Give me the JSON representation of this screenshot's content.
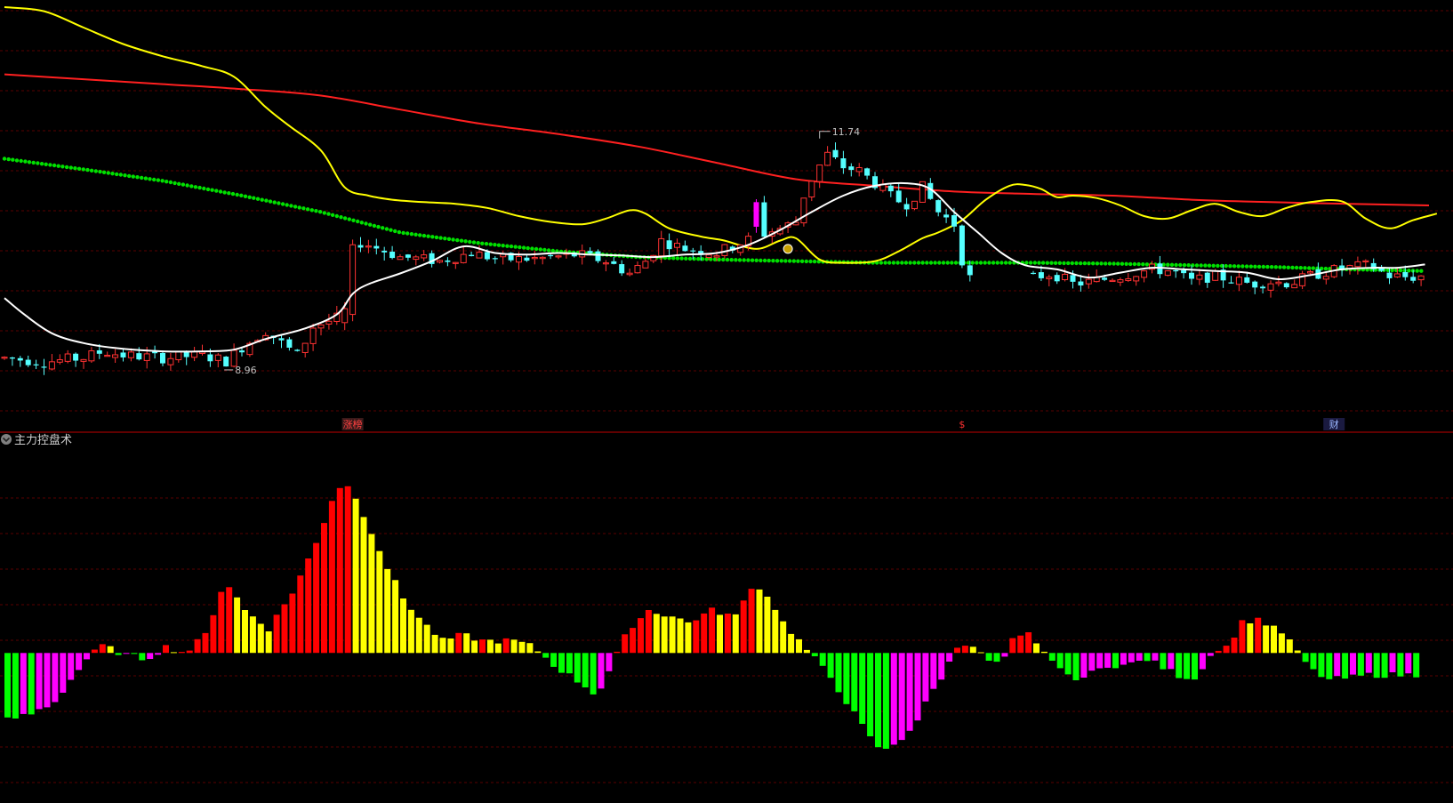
{
  "panel": {
    "indicator_name": "主力控盘术",
    "collapse_icon": "circle-chevron-down-icon"
  },
  "price_labels": {
    "low": "8.96",
    "high": "11.74"
  },
  "event_markers": [
    {
      "text": "涨榜",
      "color": "#ff4040",
      "bg": "#3a1a1a",
      "index": 88
    },
    {
      "text": "$",
      "color": "#ff3030",
      "bg": "",
      "index": 242
    },
    {
      "text": "财",
      "color": "#9bb8ff",
      "bg": "#1a1a40",
      "index": 336
    }
  ],
  "colors": {
    "background": "#000000",
    "grid": "#5a0000",
    "separator": "#c00000",
    "up_candle": "#ff3232",
    "down_candle": "#54ffff",
    "ma_white": "#ffffff",
    "ma_yellow": "#ffff00",
    "ma_red": "#ff2020",
    "dotted_green": "#00e000",
    "bar_red": "#ff0000",
    "bar_yellow": "#ffff00",
    "bar_green": "#00ff00",
    "bar_magenta": "#ff00ff"
  },
  "chart_data": [
    {
      "type": "candlestick",
      "x_range": [
        0,
        365
      ],
      "ylim": [
        8.2,
        13.3
      ],
      "grid": "dashed horizontal",
      "anchors": [
        [
          0,
          9.02
        ],
        [
          10,
          8.97
        ],
        [
          20,
          9.02
        ],
        [
          25,
          9.1
        ],
        [
          30,
          9.05
        ],
        [
          40,
          9.02
        ],
        [
          50,
          9.05
        ],
        [
          56,
          8.98
        ],
        [
          60,
          9.15
        ],
        [
          66,
          9.35
        ],
        [
          70,
          9.2
        ],
        [
          74,
          9.05
        ],
        [
          78,
          9.4
        ],
        [
          84,
          9.5
        ],
        [
          88,
          10.45
        ],
        [
          92,
          10.4
        ],
        [
          100,
          10.25
        ],
        [
          110,
          10.2
        ],
        [
          118,
          10.3
        ],
        [
          125,
          10.22
        ],
        [
          135,
          10.23
        ],
        [
          145,
          10.28
        ],
        [
          152,
          10.2
        ],
        [
          158,
          10.05
        ],
        [
          162,
          10.2
        ],
        [
          166,
          10.45
        ],
        [
          172,
          10.35
        ],
        [
          180,
          10.3
        ],
        [
          190,
          10.5
        ],
        [
          196,
          10.6
        ],
        [
          200,
          10.68
        ],
        [
          202,
          11.0
        ],
        [
          205,
          11.3
        ],
        [
          208,
          11.5
        ],
        [
          212,
          11.35
        ],
        [
          216,
          11.3
        ],
        [
          220,
          11.15
        ],
        [
          225,
          10.95
        ],
        [
          228,
          10.9
        ],
        [
          232,
          11.1
        ],
        [
          236,
          10.8
        ],
        [
          240,
          10.65
        ],
        [
          243,
          10.0
        ],
        [
          250,
          9.95
        ],
        [
          255,
          9.92
        ],
        [
          260,
          10.0
        ],
        [
          265,
          10.05
        ],
        [
          270,
          9.92
        ],
        [
          275,
          9.95
        ],
        [
          280,
          10.0
        ],
        [
          285,
          10.05
        ],
        [
          290,
          10.1
        ],
        [
          295,
          10.08
        ],
        [
          300,
          9.95
        ],
        [
          305,
          10.02
        ],
        [
          310,
          9.98
        ],
        [
          315,
          9.92
        ],
        [
          320,
          9.95
        ],
        [
          325,
          9.93
        ],
        [
          330,
          10.02
        ],
        [
          335,
          10.08
        ],
        [
          340,
          10.12
        ],
        [
          345,
          10.15
        ],
        [
          350,
          10.02
        ],
        [
          355,
          10.0
        ],
        [
          359,
          10.02
        ]
      ],
      "gaps": [
        [
          244,
          260
        ]
      ],
      "high_point": {
        "index": 206,
        "value": 11.74
      },
      "low_point": {
        "index": 56,
        "value": 8.96
      },
      "series": [
        {
          "name": "",
          "type": "line",
          "color": "#ffffff",
          "points": [
            [
              0,
              9.75
            ],
            [
              5,
              9.55
            ],
            [
              12,
              9.32
            ],
            [
              20,
              9.2
            ],
            [
              30,
              9.13
            ],
            [
              40,
              9.1
            ],
            [
              50,
              9.1
            ],
            [
              58,
              9.12
            ],
            [
              66,
              9.25
            ],
            [
              76,
              9.38
            ],
            [
              84,
              9.55
            ],
            [
              88,
              9.8
            ],
            [
              92,
              9.92
            ],
            [
              100,
              10.05
            ],
            [
              108,
              10.2
            ],
            [
              116,
              10.38
            ],
            [
              124,
              10.3
            ],
            [
              132,
              10.28
            ],
            [
              140,
              10.3
            ],
            [
              148,
              10.28
            ],
            [
              156,
              10.27
            ],
            [
              164,
              10.25
            ],
            [
              172,
              10.28
            ],
            [
              180,
              10.3
            ],
            [
              188,
              10.4
            ],
            [
              196,
              10.58
            ],
            [
              204,
              10.8
            ],
            [
              212,
              11.0
            ],
            [
              220,
              11.12
            ],
            [
              228,
              11.15
            ],
            [
              234,
              11.08
            ],
            [
              240,
              10.8
            ],
            [
              246,
              10.55
            ],
            [
              252,
              10.3
            ],
            [
              258,
              10.15
            ],
            [
              266,
              10.1
            ],
            [
              274,
              10.0
            ],
            [
              282,
              10.06
            ],
            [
              290,
              10.12
            ],
            [
              298,
              10.1
            ],
            [
              306,
              10.08
            ],
            [
              314,
              10.06
            ],
            [
              322,
              9.98
            ],
            [
              330,
              10.03
            ],
            [
              338,
              10.1
            ],
            [
              346,
              10.12
            ],
            [
              352,
              10.12
            ],
            [
              359,
              10.16
            ]
          ]
        },
        {
          "name": "",
          "type": "line",
          "color": "#ffff00",
          "points": [
            [
              0,
              13.3
            ],
            [
              10,
              13.25
            ],
            [
              20,
              13.05
            ],
            [
              30,
              12.85
            ],
            [
              40,
              12.7
            ],
            [
              50,
              12.58
            ],
            [
              58,
              12.45
            ],
            [
              66,
              12.08
            ],
            [
              72,
              11.85
            ],
            [
              80,
              11.55
            ],
            [
              86,
              11.1
            ],
            [
              92,
              11.0
            ],
            [
              98,
              10.95
            ],
            [
              106,
              10.92
            ],
            [
              114,
              10.9
            ],
            [
              122,
              10.85
            ],
            [
              130,
              10.75
            ],
            [
              138,
              10.68
            ],
            [
              146,
              10.65
            ],
            [
              152,
              10.72
            ],
            [
              158,
              10.82
            ],
            [
              162,
              10.78
            ],
            [
              168,
              10.6
            ],
            [
              176,
              10.5
            ],
            [
              182,
              10.45
            ],
            [
              190,
              10.35
            ],
            [
              196,
              10.45
            ],
            [
              200,
              10.48
            ],
            [
              206,
              10.22
            ],
            [
              212,
              10.18
            ],
            [
              220,
              10.2
            ],
            [
              226,
              10.32
            ],
            [
              232,
              10.48
            ],
            [
              236,
              10.55
            ],
            [
              242,
              10.7
            ],
            [
              248,
              10.95
            ],
            [
              254,
              11.12
            ],
            [
              258,
              11.13
            ],
            [
              262,
              11.08
            ],
            [
              266,
              10.98
            ],
            [
              270,
              11.0
            ],
            [
              276,
              10.97
            ],
            [
              282,
              10.88
            ],
            [
              288,
              10.75
            ],
            [
              294,
              10.72
            ],
            [
              300,
              10.82
            ],
            [
              306,
              10.9
            ],
            [
              312,
              10.8
            ],
            [
              318,
              10.75
            ],
            [
              324,
              10.85
            ],
            [
              330,
              10.92
            ],
            [
              338,
              10.93
            ],
            [
              344,
              10.72
            ],
            [
              350,
              10.6
            ],
            [
              356,
              10.7
            ],
            [
              362,
              10.78
            ]
          ]
        },
        {
          "name": "",
          "type": "line",
          "color": "#ff2020",
          "points": [
            [
              0,
              12.48
            ],
            [
              20,
              12.42
            ],
            [
              40,
              12.36
            ],
            [
              60,
              12.3
            ],
            [
              80,
              12.22
            ],
            [
              100,
              12.05
            ],
            [
              120,
              11.88
            ],
            [
              140,
              11.75
            ],
            [
              160,
              11.6
            ],
            [
              180,
              11.4
            ],
            [
              200,
              11.2
            ],
            [
              220,
              11.12
            ],
            [
              240,
              11.05
            ],
            [
              260,
              11.02
            ],
            [
              280,
              11.0
            ],
            [
              300,
              10.95
            ],
            [
              320,
              10.92
            ],
            [
              340,
              10.9
            ],
            [
              360,
              10.88
            ]
          ]
        },
        {
          "name": "",
          "type": "dotted",
          "color": "#00e000",
          "points": [
            [
              0,
              11.45
            ],
            [
              20,
              11.32
            ],
            [
              40,
              11.18
            ],
            [
              60,
              11.0
            ],
            [
              80,
              10.8
            ],
            [
              100,
              10.55
            ],
            [
              120,
              10.42
            ],
            [
              140,
              10.32
            ],
            [
              160,
              10.25
            ],
            [
              180,
              10.22
            ],
            [
              200,
              10.2
            ],
            [
              220,
              10.18
            ],
            [
              240,
              10.18
            ],
            [
              260,
              10.18
            ],
            [
              280,
              10.17
            ],
            [
              300,
              10.15
            ],
            [
              320,
              10.13
            ],
            [
              340,
              10.1
            ],
            [
              359,
              10.08
            ]
          ]
        }
      ]
    },
    {
      "type": "bar",
      "title": "主力控盘术",
      "ylim": [
        -1.1,
        1.6
      ],
      "bars": 179,
      "anchors": [
        [
          0,
          -0.55
        ],
        [
          6,
          -0.5
        ],
        [
          12,
          -0.4
        ],
        [
          16,
          -0.22
        ],
        [
          20,
          -0.05
        ],
        [
          24,
          0.06
        ],
        [
          27,
          0.02
        ],
        [
          30,
          -0.02
        ],
        [
          35,
          -0.05
        ],
        [
          40,
          0.05
        ],
        [
          45,
          0.0
        ],
        [
          50,
          0.15
        ],
        [
          55,
          0.6
        ],
        [
          60,
          0.35
        ],
        [
          66,
          0.2
        ],
        [
          72,
          0.5
        ],
        [
          78,
          0.9
        ],
        [
          83,
          1.35
        ],
        [
          86,
          1.38
        ],
        [
          89,
          1.2
        ],
        [
          92,
          1.0
        ],
        [
          96,
          0.7
        ],
        [
          100,
          0.45
        ],
        [
          105,
          0.25
        ],
        [
          110,
          0.1
        ],
        [
          115,
          0.15
        ],
        [
          120,
          0.1
        ],
        [
          128,
          0.1
        ],
        [
          133,
          0.05
        ],
        [
          138,
          -0.1
        ],
        [
          145,
          -0.25
        ],
        [
          149,
          -0.35
        ],
        [
          152,
          -0.15
        ],
        [
          157,
          0.2
        ],
        [
          162,
          0.35
        ],
        [
          168,
          0.3
        ],
        [
          172,
          0.25
        ],
        [
          178,
          0.35
        ],
        [
          184,
          0.3
        ],
        [
          188,
          0.55
        ],
        [
          192,
          0.48
        ],
        [
          196,
          0.25
        ],
        [
          200,
          0.1
        ],
        [
          204,
          -0.05
        ],
        [
          208,
          -0.2
        ],
        [
          212,
          -0.4
        ],
        [
          216,
          -0.6
        ],
        [
          219,
          -0.75
        ],
        [
          222,
          -0.8
        ],
        [
          226,
          -0.7
        ],
        [
          230,
          -0.55
        ],
        [
          233,
          -0.35
        ],
        [
          237,
          -0.15
        ],
        [
          240,
          0.05
        ],
        [
          243,
          0.1
        ],
        [
          247,
          -0.05
        ],
        [
          251,
          -0.1
        ],
        [
          254,
          0.1
        ],
        [
          258,
          0.15
        ],
        [
          261,
          0.02
        ],
        [
          264,
          -0.05
        ],
        [
          268,
          -0.2
        ],
        [
          272,
          -0.2
        ],
        [
          278,
          -0.1
        ],
        [
          283,
          -0.1
        ],
        [
          288,
          -0.05
        ],
        [
          292,
          -0.12
        ],
        [
          297,
          -0.2
        ],
        [
          301,
          -0.2
        ],
        [
          304,
          0.0
        ],
        [
          308,
          0.05
        ],
        [
          312,
          0.25
        ],
        [
          316,
          0.28
        ],
        [
          320,
          0.2
        ],
        [
          323,
          0.15
        ],
        [
          326,
          0.0
        ],
        [
          330,
          -0.15
        ],
        [
          334,
          -0.22
        ],
        [
          340,
          -0.2
        ],
        [
          344,
          -0.18
        ]
      ]
    }
  ]
}
